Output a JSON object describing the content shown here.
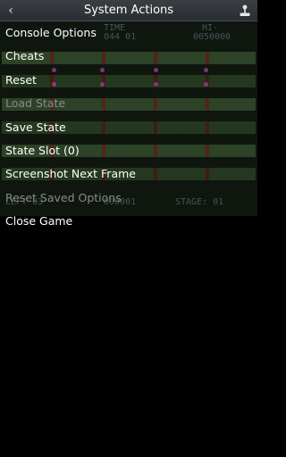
{
  "header": {
    "title": "System Actions",
    "back_icon": "chevron-left-icon",
    "joystick_icon": "joystick-icon"
  },
  "menu": [
    {
      "label": "Console Options",
      "enabled": true
    },
    {
      "label": "Cheats",
      "enabled": true
    },
    {
      "label": "Reset",
      "enabled": true
    },
    {
      "label": "Load State",
      "enabled": false
    },
    {
      "label": "Save State",
      "enabled": true
    },
    {
      "label": "State Slot (0)",
      "enabled": true
    },
    {
      "label": "Screenshot Next Frame",
      "enabled": true
    },
    {
      "label": "Reset Saved Options",
      "enabled": false
    },
    {
      "label": "Close Game",
      "enabled": true
    }
  ],
  "game_hud": {
    "time_label": "TIME",
    "time_value": "044 01",
    "hi_label": "HI-",
    "hi_value": "0050000",
    "bottom_left": "LEFT 03",
    "bottom_mid": "000001",
    "stage": "STAGE: 01"
  }
}
